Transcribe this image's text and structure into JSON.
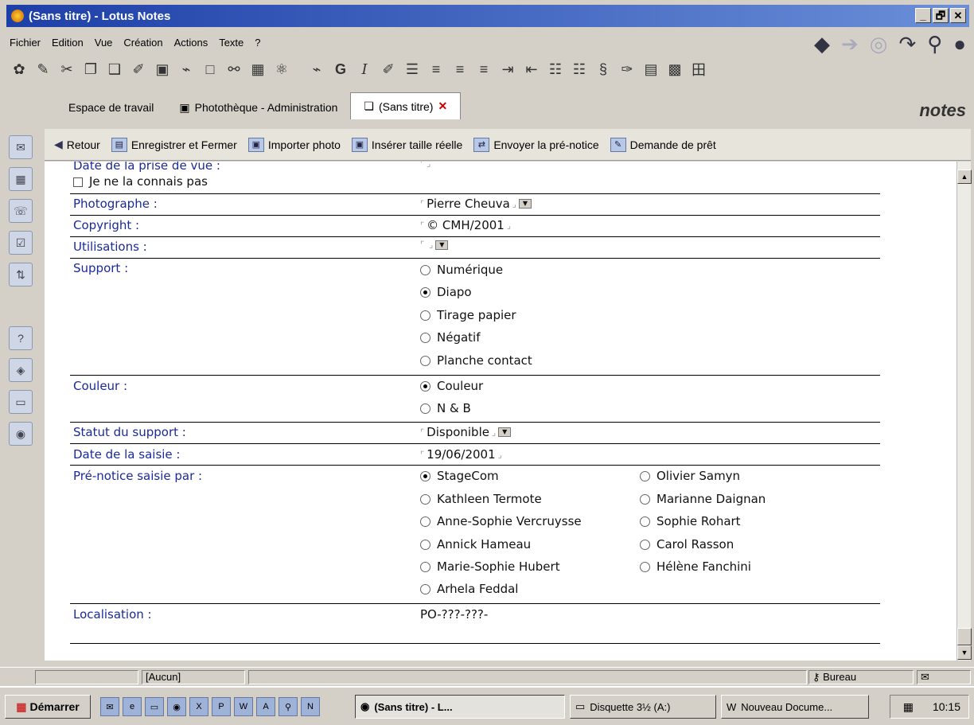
{
  "window": {
    "title": "(Sans titre) - Lotus Notes",
    "minimize": "_",
    "maximize": "🗗",
    "close": "✕"
  },
  "menu": [
    "Fichier",
    "Edition",
    "Vue",
    "Création",
    "Actions",
    "Texte",
    "?"
  ],
  "tabs": [
    {
      "label": "Espace de travail",
      "icon": "workspace-icon"
    },
    {
      "label": "Photothèque - Administration",
      "icon": "database-icon"
    },
    {
      "label": "(Sans titre)",
      "icon": "document-icon",
      "active": true
    }
  ],
  "brand": "notes",
  "actions": [
    {
      "label": "Retour",
      "icon": "back-arrow-icon"
    },
    {
      "label": "Enregistrer et Fermer",
      "icon": "save-close-icon"
    },
    {
      "label": "Importer photo",
      "icon": "import-icon"
    },
    {
      "label": "Insérer taille réelle",
      "icon": "insert-icon"
    },
    {
      "label": "Envoyer la pré-notice",
      "icon": "send-icon"
    },
    {
      "label": "Demande de prêt",
      "icon": "loan-icon"
    }
  ],
  "form": {
    "date_prise": {
      "label": "Date de la prise de vue :"
    },
    "unknown_date": "Je ne la connais pas",
    "photographe": {
      "label": "Photographe :",
      "value": "Pierre Cheuva"
    },
    "copyright": {
      "label": "Copyright :",
      "value": "© CMH/2001"
    },
    "utilisations": {
      "label": "Utilisations :",
      "value": ""
    },
    "support": {
      "label": "Support :",
      "options": [
        "Numérique",
        "Diapo",
        "Tirage papier",
        "Négatif",
        "Planche contact"
      ],
      "selected": "Diapo"
    },
    "couleur": {
      "label": "Couleur :",
      "options": [
        "Couleur",
        "N & B"
      ],
      "selected": "Couleur"
    },
    "statut": {
      "label": "Statut du support :",
      "value": "Disponible"
    },
    "date_saisie": {
      "label": "Date de la saisie :",
      "value": "19/06/2001"
    },
    "prenotice": {
      "label": "Pré-notice saisie par :",
      "col1": [
        "StageCom",
        "Kathleen Termote",
        "Anne-Sophie Vercruysse",
        "Annick Hameau",
        "Marie-Sophie Hubert",
        "Arhela Feddal"
      ],
      "col2": [
        "Olivier Samyn",
        "Marianne Daignan",
        "Sophie Rohart",
        "Carol Rasson",
        "Hélène Fanchini"
      ],
      "selected": "StageCom"
    },
    "localisation": {
      "label": "Localisation :",
      "value": "PO-???-???-"
    }
  },
  "status": {
    "field2": "[Aucun]",
    "location": "Bureau"
  },
  "taskbar": {
    "start": "Démarrer",
    "buttons": [
      "(Sans titre) - L...",
      "Disquette 3½ (A:)",
      "Nouveau Docume..."
    ],
    "clock": "10:15"
  }
}
